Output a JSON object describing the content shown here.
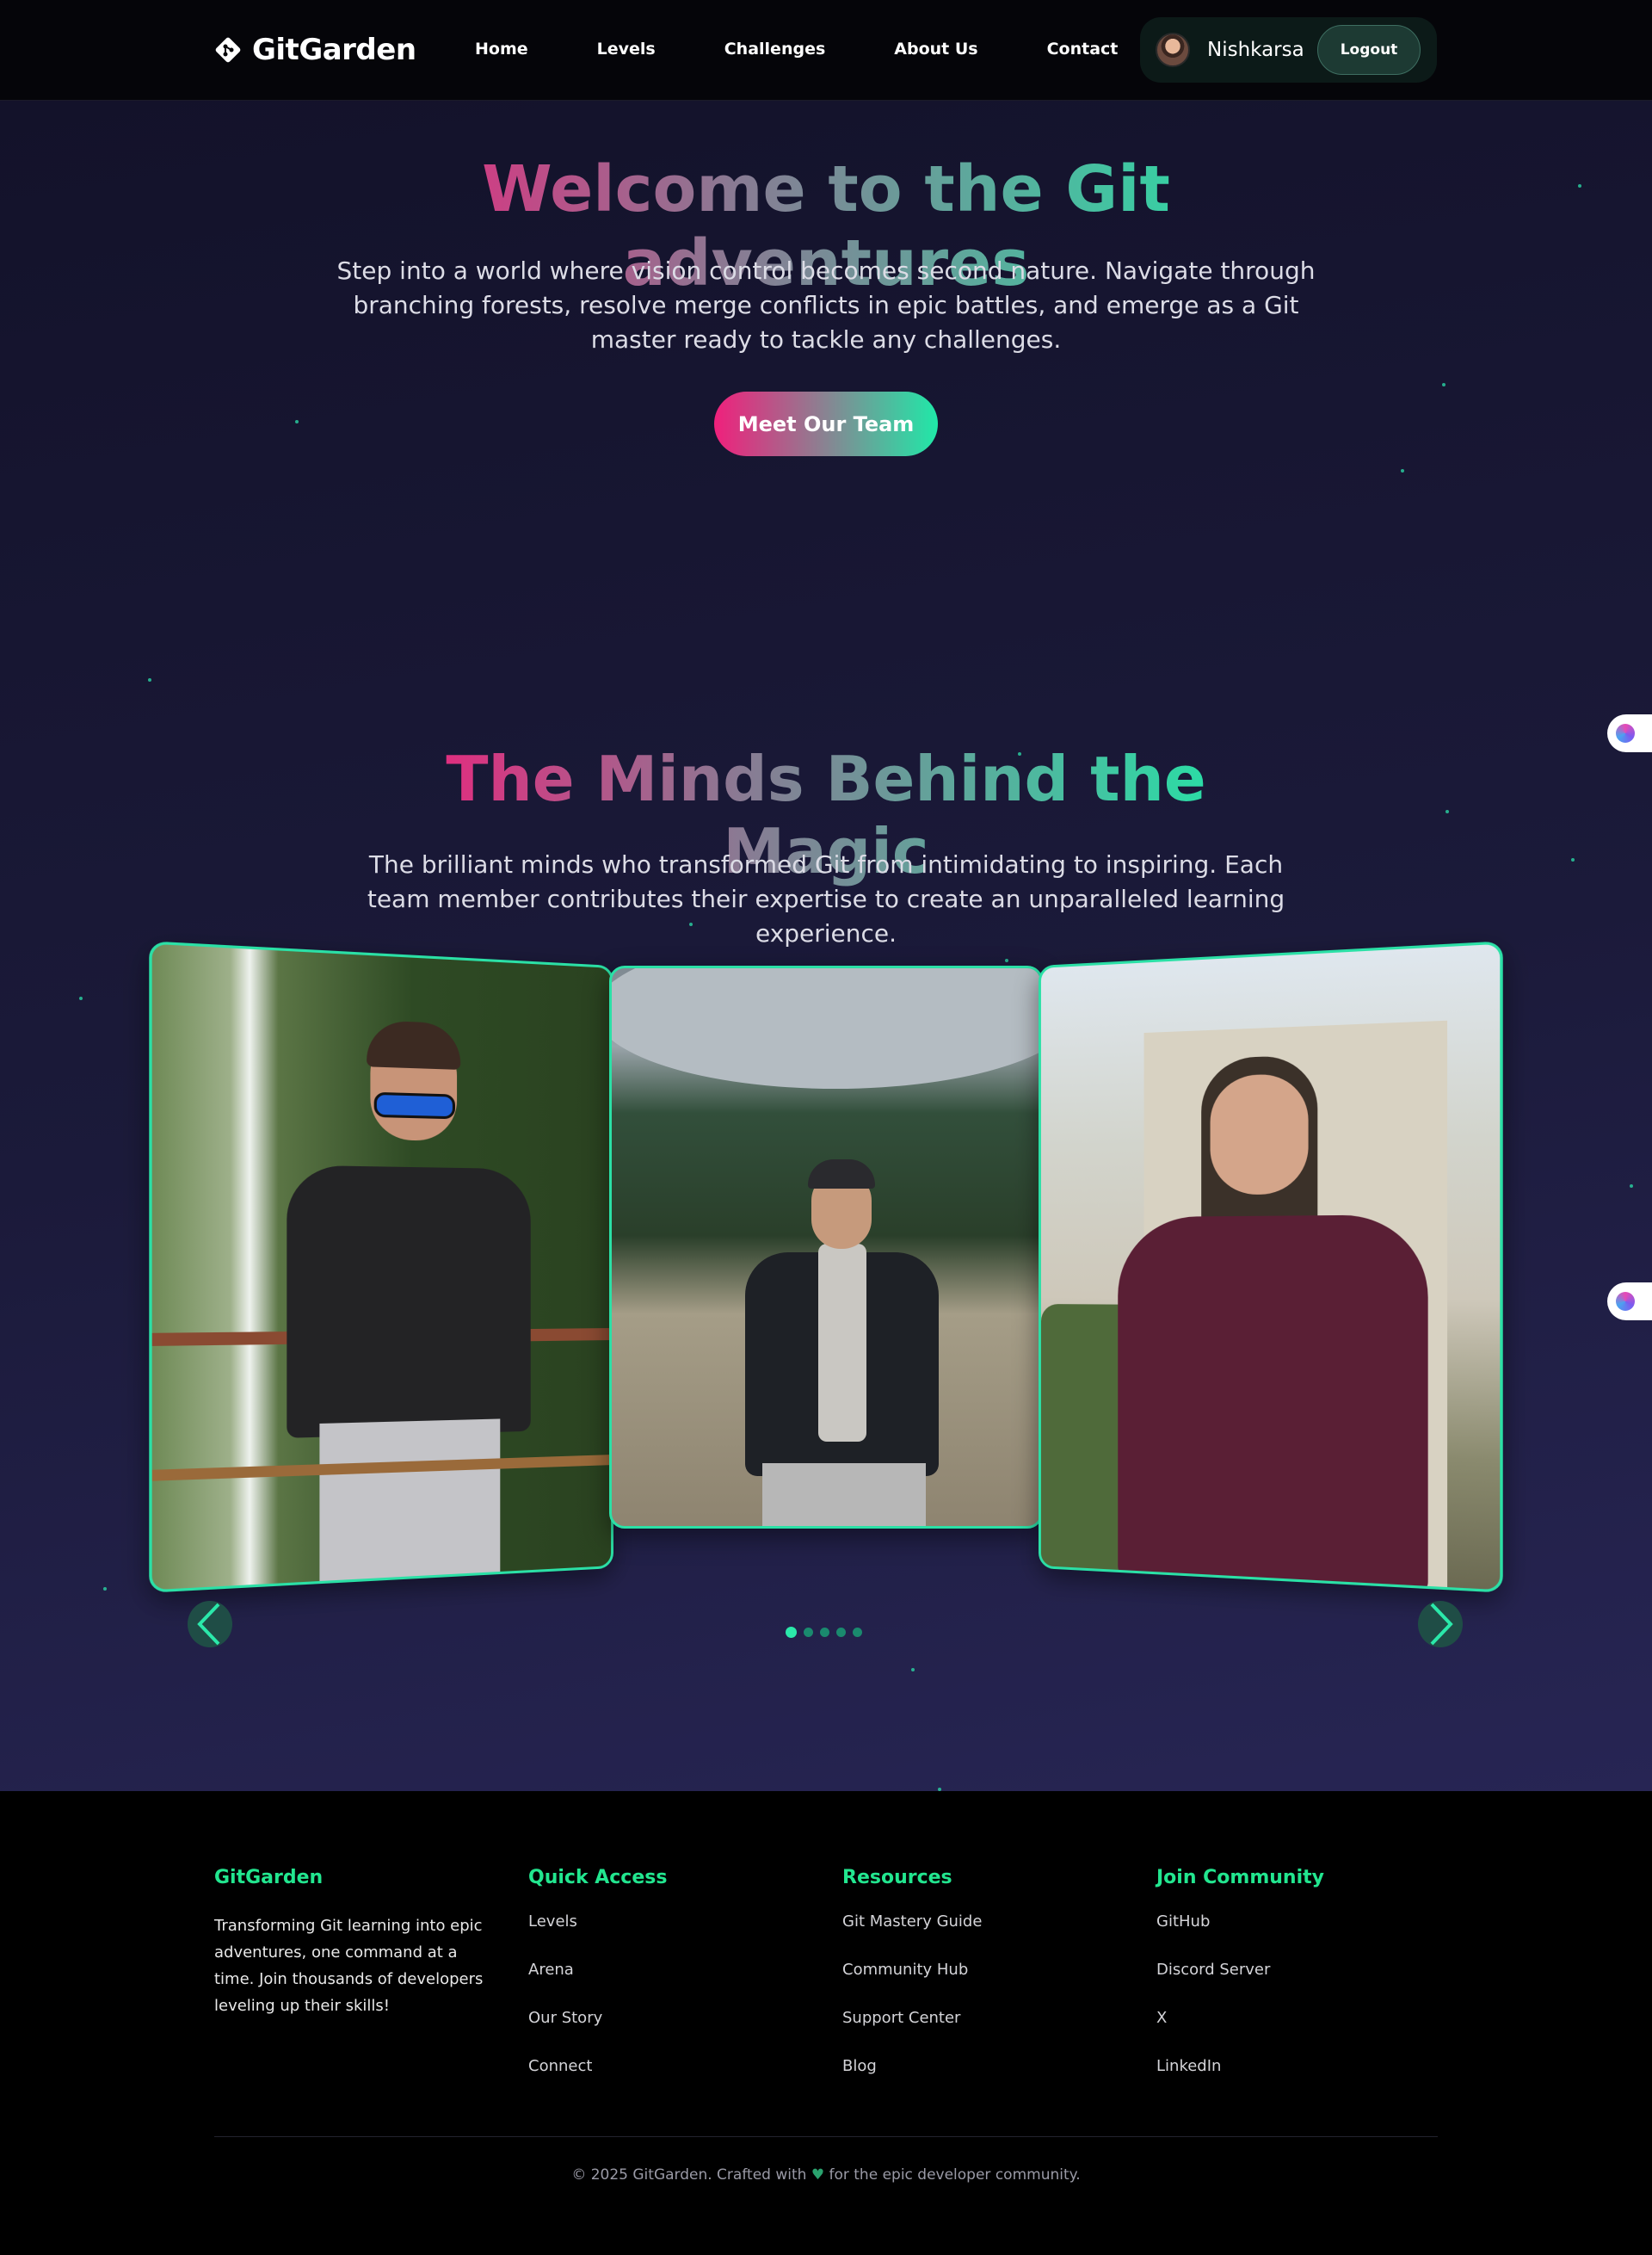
{
  "nav": {
    "logo": "GitGarden",
    "links": [
      "Home",
      "Levels",
      "Challenges",
      "About Us",
      "Contact"
    ],
    "username": "Nishkarsa",
    "logout_label": "Logout"
  },
  "hero": {
    "title": "Welcome to the Git adventures",
    "text": "Step into a world where vision control becomes second nature. Navigate through branching forests, resolve merge conflicts in epic battles, and emerge as a Git master ready to tackle any challenges.",
    "button": "Meet Our Team"
  },
  "team": {
    "title": "The Minds Behind the Magic",
    "text": "The brilliant minds who transformed Git from intimidating to inspiring. Each team member contributes their expertise to create an unparalleled learning experience.",
    "carousel": {
      "active_index": 0,
      "total": 5
    }
  },
  "footer": {
    "brand": {
      "title": "GitGarden",
      "text": "Transforming Git learning into epic adventures, one command at a time. Join thousands of developers leveling up their skills!"
    },
    "quick_access": {
      "title": "Quick Access",
      "links": [
        "Levels",
        "Arena",
        "Our Story",
        "Connect"
      ]
    },
    "resources": {
      "title": "Resources",
      "links": [
        "Git Mastery Guide",
        "Community Hub",
        "Support Center",
        "Blog"
      ]
    },
    "community": {
      "title": "Join Community",
      "links": [
        "GitHub",
        "Discord Server",
        "X",
        "LinkedIn"
      ]
    },
    "copyright_before": "© 2025 GitGarden. Crafted with",
    "heart": "♥",
    "copyright_after": "for the epic developer community."
  },
  "colors": {
    "accent_pink": "#f0207c",
    "accent_green": "#20e8a8",
    "footer_heading": "#22e68f"
  }
}
